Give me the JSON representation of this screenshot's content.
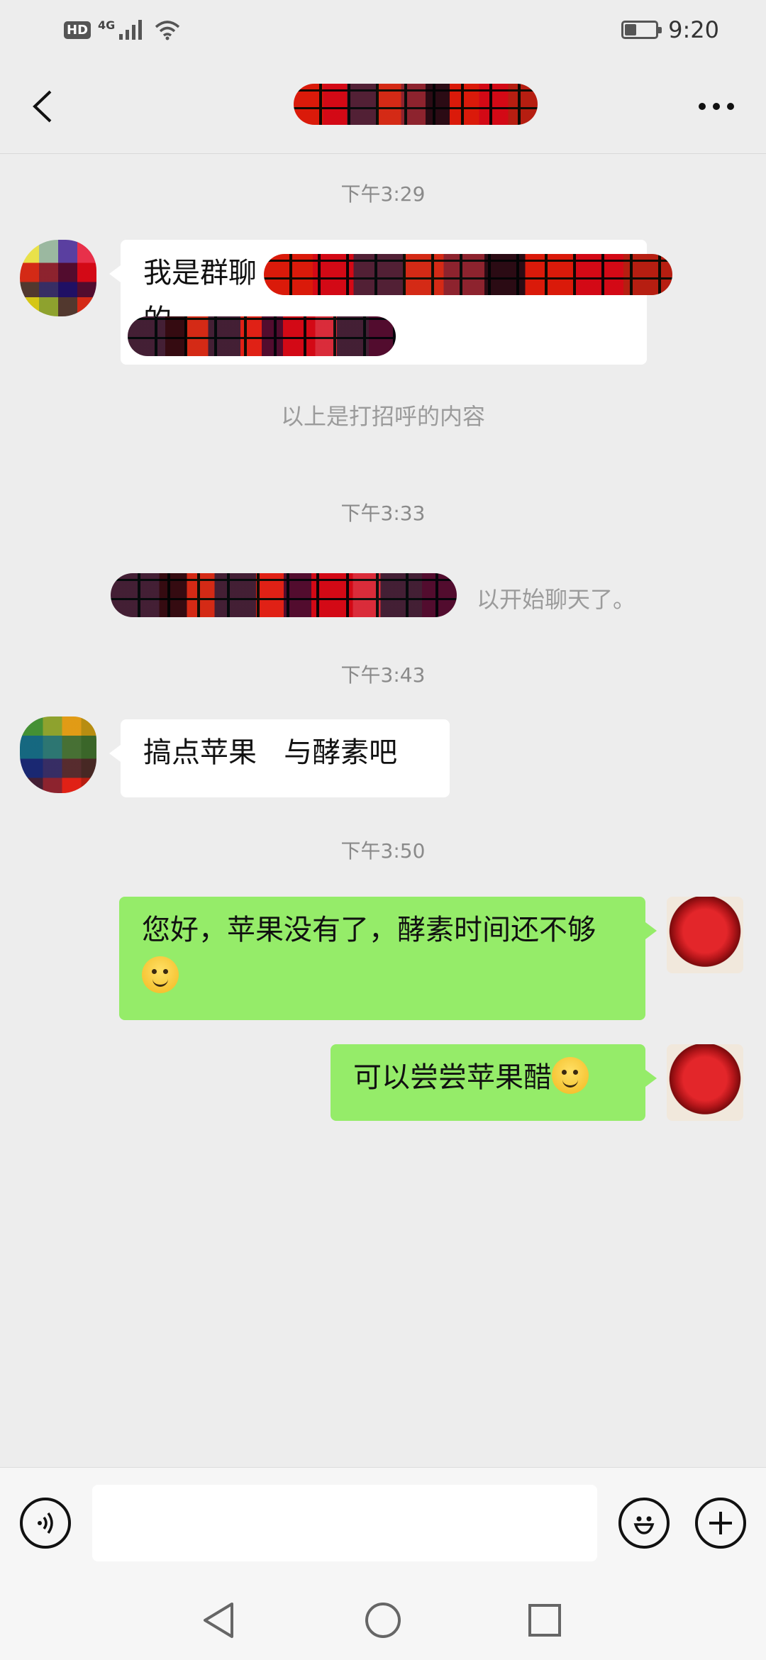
{
  "status_bar": {
    "hd_badge": "HD",
    "network": "4G",
    "battery_level": 0.35,
    "time": "9:20"
  },
  "header": {
    "back_icon": "chevron-left-icon",
    "more_icon": "more-dots-icon"
  },
  "chat": {
    "timestamps": [
      "下午3:29",
      "下午3:33",
      "下午3:43",
      "下午3:50"
    ],
    "greeting_note": "以上是打招呼的内容",
    "system_message_visible": "以开始聊天了。",
    "messages": [
      {
        "side": "left",
        "text": "我是群聊",
        "continued": "的"
      },
      {
        "side": "left",
        "text": "搞点苹果   与酵素吧"
      },
      {
        "side": "right",
        "text": "您好，苹果没有了，酵素时间还不够",
        "emoji": "shy-smile-emoji"
      },
      {
        "side": "right",
        "text": "可以尝尝苹果醋",
        "emoji": "smile-emoji"
      }
    ]
  },
  "input_bar": {
    "voice_icon": "voice-icon",
    "emoji_icon": "emoji-icon",
    "plus_icon": "plus-icon",
    "placeholder": ""
  },
  "nav_bar": {
    "back_icon": "nav-back-icon",
    "home_icon": "nav-home-icon",
    "recents_icon": "nav-recents-icon"
  },
  "colors": {
    "background": "#ededed",
    "bubble_self": "#95ec69",
    "bubble_other": "#ffffff",
    "timestamp_text": "#8a8a8a"
  }
}
